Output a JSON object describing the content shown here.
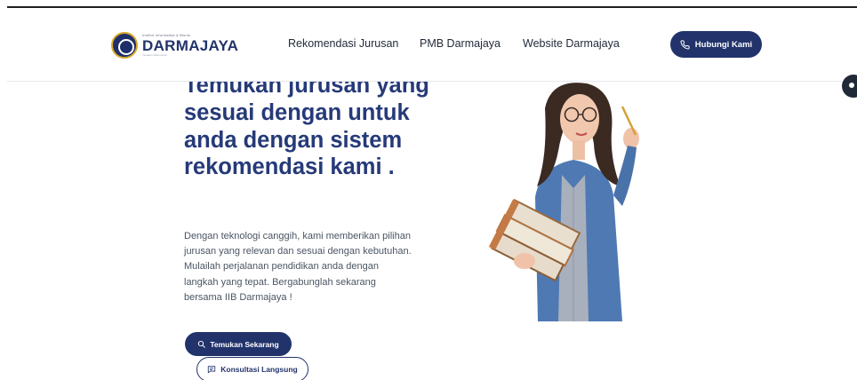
{
  "header": {
    "logo": {
      "tagline": "Institut Informatika & Bisnis",
      "name": "DARMAJAYA",
      "subtitle": "Yayasan Alfian Husin"
    },
    "nav": [
      {
        "label": "Rekomendasi Jurusan"
      },
      {
        "label": "PMB Darmajaya"
      },
      {
        "label": "Website Darmajaya"
      }
    ],
    "contact_button": {
      "label": "Hubungi Kami",
      "icon": "phone-icon"
    }
  },
  "hero": {
    "title": "Temukan jurusan yang sesuai dengan untuk anda dengan sistem rekomendasi kami .",
    "description": "Dengan teknologi canggih, kami memberikan pilihan jurusan yang relevan dan sesuai dengan kebutuhan. Mulailah perjalanan pendidikan anda dengan langkah yang tepat. Bergabunglah sekarang bersama IIB Darmajaya !",
    "primary_button": {
      "label": "Temukan Sekarang",
      "icon": "search-icon"
    },
    "secondary_button": {
      "label": "Konsultasi Langsung",
      "icon": "chat-icon"
    }
  },
  "colors": {
    "brand": "#22336b",
    "title": "#263a79",
    "body_text": "#4b5563"
  }
}
